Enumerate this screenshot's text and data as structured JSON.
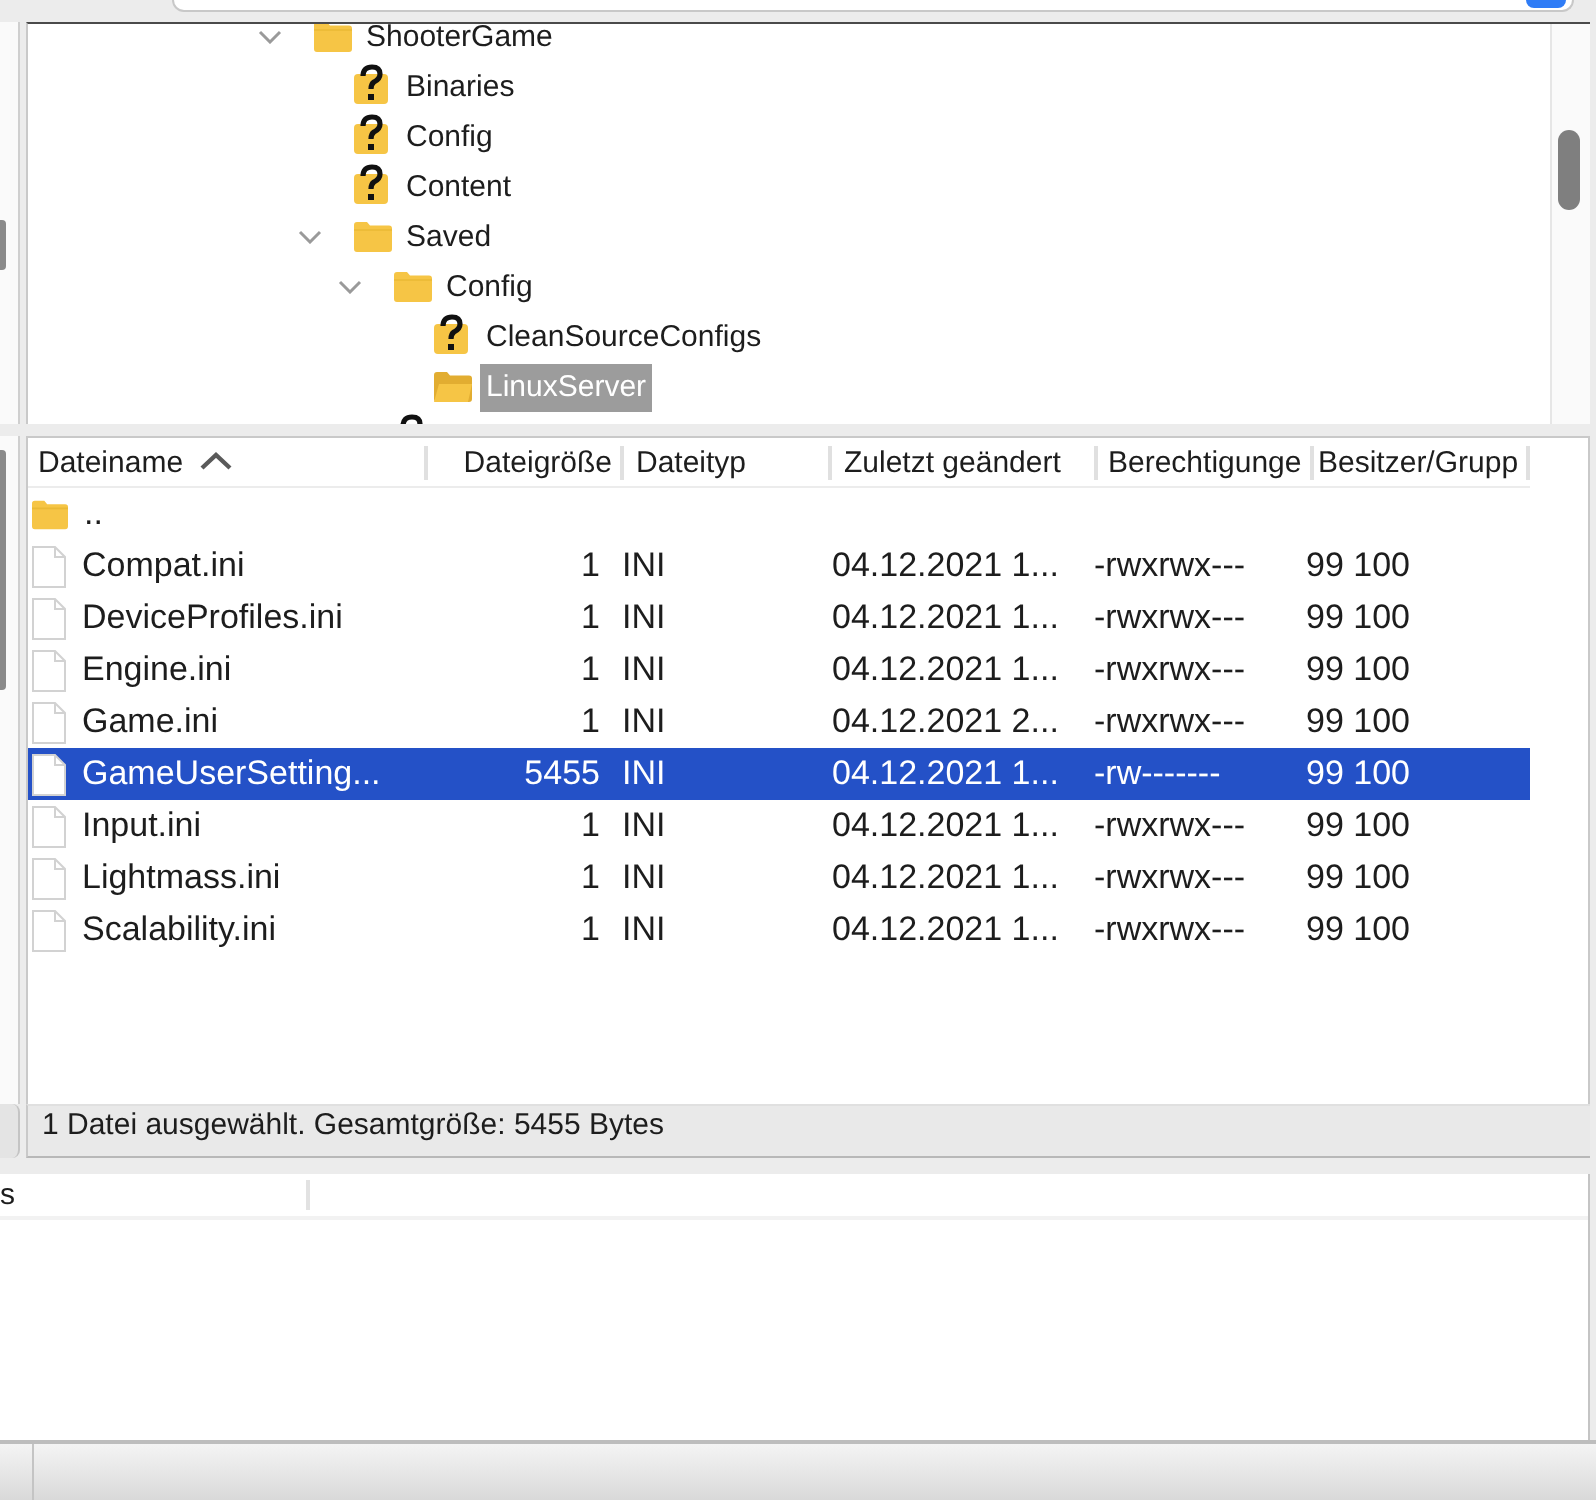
{
  "remote_tree": {
    "items": [
      {
        "label": "ShooterGame",
        "kind": "folder",
        "expanded": true,
        "selected": false,
        "children": [
          {
            "label": "Binaries",
            "kind": "unknown",
            "selected": false
          },
          {
            "label": "Config",
            "kind": "unknown",
            "selected": false
          },
          {
            "label": "Content",
            "kind": "unknown",
            "selected": false
          },
          {
            "label": "Saved",
            "kind": "folder",
            "expanded": true,
            "selected": false,
            "children": [
              {
                "label": "Config",
                "kind": "folder",
                "expanded": true,
                "selected": false,
                "children": [
                  {
                    "label": "CleanSourceConfigs",
                    "kind": "unknown",
                    "selected": false
                  },
                  {
                    "label": "LinuxServer",
                    "kind": "open-folder",
                    "selected": true
                  }
                ]
              },
              {
                "kind": "unknown"
              }
            ]
          }
        ]
      }
    ]
  },
  "file_list": {
    "columns": [
      {
        "label": "Dateiname",
        "sorted": true
      },
      {
        "label": "Dateigröße",
        "sorted": false
      },
      {
        "label": "Dateityp",
        "sorted": false
      },
      {
        "label": "Zuletzt geändert",
        "sorted": false
      },
      {
        "label": "Berechtigunge",
        "sorted": false
      },
      {
        "label": "Besitzer/Grupp",
        "sorted": false
      }
    ],
    "rows": [
      {
        "kind": "parent",
        "name": "..",
        "selected": false
      },
      {
        "kind": "file",
        "name": "Compat.ini",
        "size": "1",
        "type": "INI",
        "modified": "04.12.2021 1...",
        "permissions": "-rwxrwx---",
        "owner": "99 100",
        "selected": false
      },
      {
        "kind": "file",
        "name": "DeviceProfiles.ini",
        "size": "1",
        "type": "INI",
        "modified": "04.12.2021 1...",
        "permissions": "-rwxrwx---",
        "owner": "99 100",
        "selected": false
      },
      {
        "kind": "file",
        "name": "Engine.ini",
        "size": "1",
        "type": "INI",
        "modified": "04.12.2021 1...",
        "permissions": "-rwxrwx---",
        "owner": "99 100",
        "selected": false
      },
      {
        "kind": "file",
        "name": "Game.ini",
        "size": "1",
        "type": "INI",
        "modified": "04.12.2021 2...",
        "permissions": "-rwxrwx---",
        "owner": "99 100",
        "selected": false
      },
      {
        "kind": "file",
        "name": "GameUserSetting...",
        "size": "5455",
        "type": "INI",
        "modified": "04.12.2021 1...",
        "permissions": "-rw-------",
        "owner": "99 100",
        "selected": true
      },
      {
        "kind": "file",
        "name": "Input.ini",
        "size": "1",
        "type": "INI",
        "modified": "04.12.2021 1...",
        "permissions": "-rwxrwx---",
        "owner": "99 100",
        "selected": false
      },
      {
        "kind": "file",
        "name": "Lightmass.ini",
        "size": "1",
        "type": "INI",
        "modified": "04.12.2021 1...",
        "permissions": "-rwxrwx---",
        "owner": "99 100",
        "selected": false
      },
      {
        "kind": "file",
        "name": "Scalability.ini",
        "size": "1",
        "type": "INI",
        "modified": "04.12.2021 1...",
        "permissions": "-rwxrwx---",
        "owner": "99 100",
        "selected": false
      }
    ]
  },
  "status_bar": {
    "text": "1 Datei ausgewählt. Gesamtgröße: 5455 Bytes"
  },
  "queue": {
    "columns": [
      {
        "label": "s"
      }
    ]
  }
}
